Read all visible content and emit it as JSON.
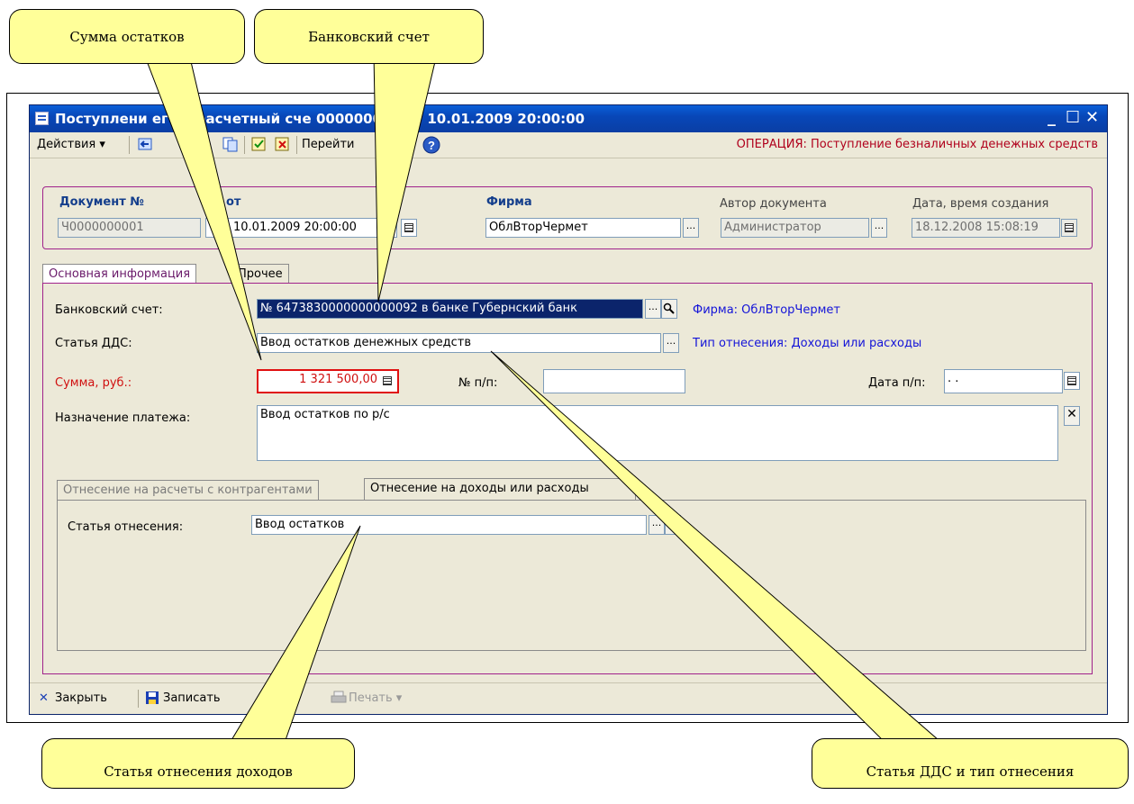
{
  "window": {
    "title": "Поступление на расчетный счет 000000001 от 10.01.2009 20:00:00",
    "title_visible": "Поступлени   ег на расчетный сче   000000001 от 10.01.2009 20:00:00"
  },
  "toolbar": {
    "actions_label": "Действия ▾",
    "goto_label": "Перейти",
    "operation": "ОПЕРАЦИЯ: Поступление безналичных денежных средств"
  },
  "header": {
    "doc_number_label": "Документ №",
    "doc_number_value": "Ч0000000001",
    "date_label": "от",
    "date_value": "10.01.2009 20:00:00",
    "firm_label": "Фирма",
    "firm_value": "ОблВторЧермет",
    "author_label": "Автор документа",
    "author_value": "Администратор",
    "created_label": "Дата, время создания",
    "created_value": "18.12.2008 15:08:19"
  },
  "tabs": {
    "main": "Основная информация",
    "other": "Прочее"
  },
  "form": {
    "bank_account_label": "Банковский счет:",
    "bank_account_value": "№ 6473830000000000092 в банке Губернский банк",
    "bank_link": "Фирма: ОблВторЧермет",
    "dds_label": "Статья ДДС:",
    "dds_value": "Ввод остатков денежных средств",
    "dds_link": "Тип отнесения: Доходы или расходы",
    "sum_label": "Сумма, руб.:",
    "sum_value": "1 321 500,00",
    "pp_num_label": "№ п/п:",
    "pp_num_value": "",
    "pp_date_label": "Дата п/п:",
    "pp_date_value": " .  . ",
    "purpose_label": "Назначение платежа:",
    "purpose_value": "Ввод остатков по р/с"
  },
  "subtabs": {
    "contractors": "Отнесение на расчеты с контрагентами",
    "income": "Отнесение на доходы или расходы"
  },
  "subform": {
    "article_label": "Статья отнесения:",
    "article_value": "Ввод остатков"
  },
  "bottombar": {
    "close_label": "Закрыть",
    "save_label": "Записать",
    "print_label": "Печать ▾"
  },
  "callouts": {
    "sum": "Сумма остатков",
    "bank": "Банковский счет",
    "article": "Статья отнесения доходов",
    "dds": "Статья ДДС и тип отнесения"
  },
  "colors": {
    "title_bar": "#0a4cc0",
    "accent_frame": "#a0228b",
    "operation_text": "#b0001c",
    "link_text": "#1414d8",
    "callout_fill": "#ffff99"
  },
  "icons": [
    "form-icon",
    "back-arrow-icon",
    "copy-icon",
    "post-icon",
    "unpost-icon",
    "help-icon",
    "calendar-icon",
    "search-icon",
    "clear-icon",
    "close-x-icon",
    "save-disk-icon",
    "print-icon"
  ]
}
